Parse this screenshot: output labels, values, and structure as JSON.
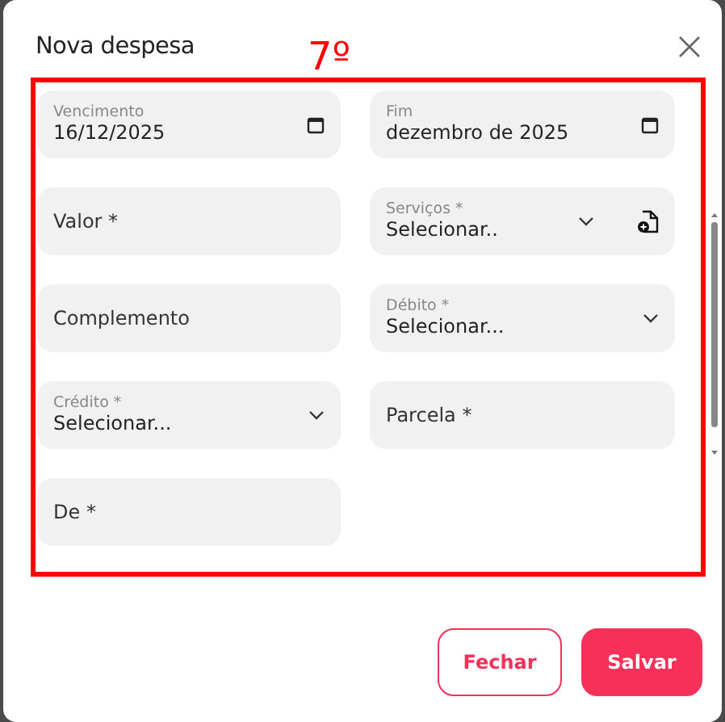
{
  "dialog": {
    "title": "Nova despesa",
    "annotation": "7º"
  },
  "field_rows": [
    [
      {
        "kind": "date",
        "label": "Vencimento",
        "value": "16/12/2025"
      },
      {
        "kind": "date",
        "label": "Fim",
        "value": "dezembro de 2025"
      }
    ],
    [
      {
        "kind": "text",
        "placeholder": "Valor *"
      },
      {
        "kind": "select",
        "label": "Serviços *",
        "value": "Selecionar..",
        "add_icon": true
      }
    ],
    [
      {
        "kind": "text",
        "placeholder": "Complemento"
      },
      {
        "kind": "select",
        "label": "Débito *",
        "value": "Selecionar..."
      }
    ],
    [
      {
        "kind": "select",
        "label": "Crédito *",
        "value": "Selecionar..."
      },
      {
        "kind": "text",
        "placeholder": "Parcela *"
      }
    ],
    [
      {
        "kind": "text",
        "placeholder": "De *"
      }
    ]
  ],
  "buttons": [
    {
      "kind": "secondary",
      "label": "Fechar"
    },
    {
      "kind": "primary",
      "label": "Salvar"
    }
  ]
}
